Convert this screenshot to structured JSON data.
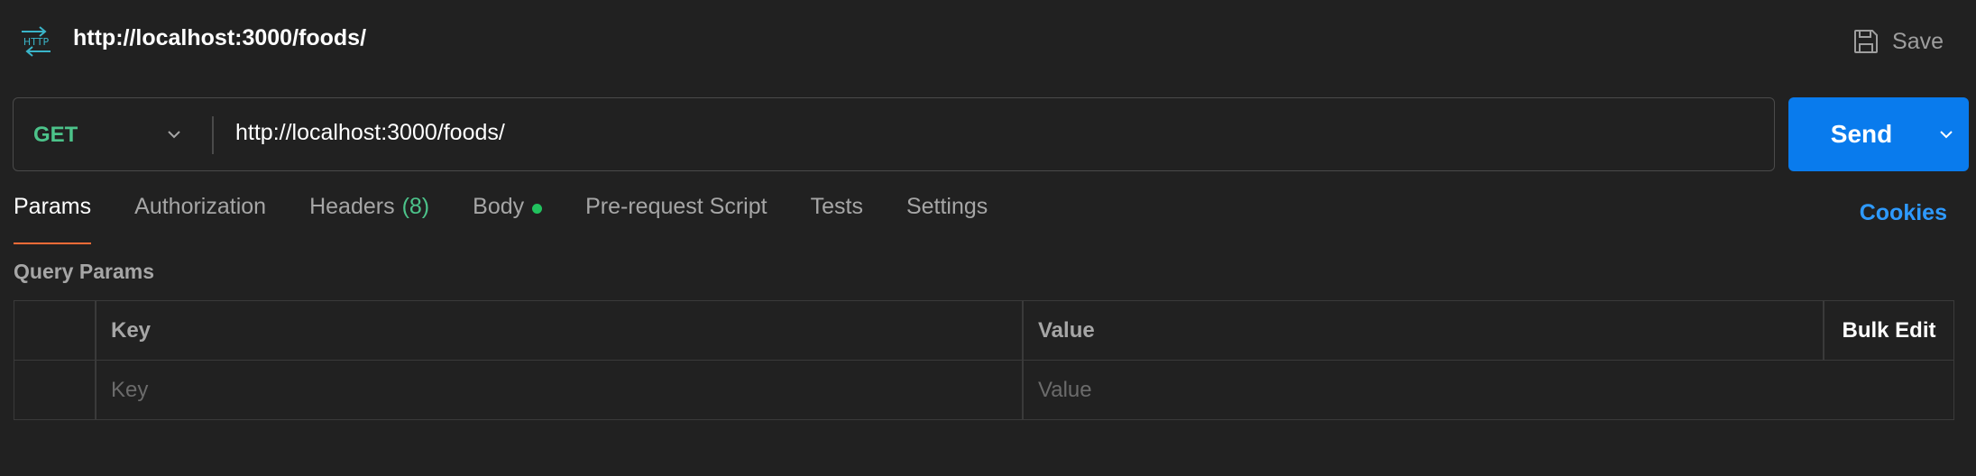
{
  "request": {
    "type_icon": "http-icon",
    "title": "http://localhost:3000/foods/",
    "save_label": "Save"
  },
  "urlbar": {
    "method": "GET",
    "method_color": "#4cc38a",
    "url": "http://localhost:3000/foods/",
    "send_label": "Send",
    "send_color": "#097bed"
  },
  "tabs": [
    {
      "label": "Params",
      "active": true
    },
    {
      "label": "Authorization"
    },
    {
      "label": "Headers",
      "count": "(8)"
    },
    {
      "label": "Body",
      "indicator": "green-dot"
    },
    {
      "label": "Pre-request Script"
    },
    {
      "label": "Tests"
    },
    {
      "label": "Settings"
    }
  ],
  "cookies_label": "Cookies",
  "query_params": {
    "title": "Query Params",
    "columns": {
      "key": "Key",
      "value": "Value",
      "bulk_edit": "Bulk Edit"
    },
    "placeholder": {
      "key": "Key",
      "value": "Value"
    }
  },
  "colors": {
    "accent_tab": "#ff6c37",
    "link": "#2e9aff",
    "background": "#212121"
  }
}
